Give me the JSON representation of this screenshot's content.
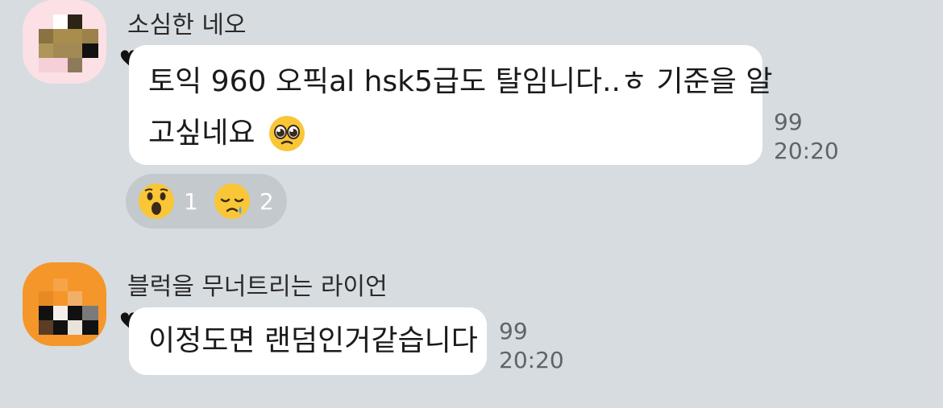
{
  "messages": [
    {
      "sender": "소심한 네오",
      "avatar_bg": "#fbe0e6",
      "text_line1": "토익 960 오픽al hsk5급도 탈임니다..ㅎ 기준을 알",
      "text_line2": "고싶네요",
      "emoji_icon": "pleading-face-emoji",
      "read_count": "99",
      "time": "20:20",
      "reactions": [
        {
          "icon": "surprised-face-emoji",
          "count": "1"
        },
        {
          "icon": "sad-tear-face-emoji",
          "count": "2"
        }
      ]
    },
    {
      "sender": "블럭을 무너트리는 라이언",
      "avatar_bg": "#f4962a",
      "text": "이정도면 랜덤인거같습니다",
      "read_count": "99",
      "time": "20:20"
    }
  ],
  "colors": {
    "background": "#d7dce0",
    "bubble": "#ffffff",
    "reaction_pill": "#c4c9cd",
    "meta_text": "#5f6468"
  }
}
